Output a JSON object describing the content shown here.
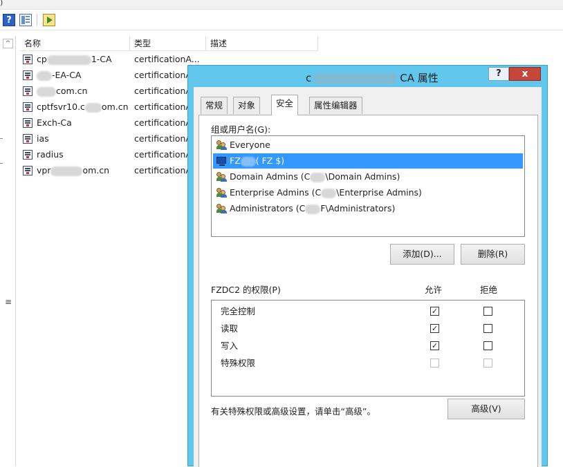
{
  "topstrip": {
    "text": ")"
  },
  "toolbar": {
    "icons": [
      "help-icon",
      "console-tree-icon",
      "action-icon"
    ],
    "help_label": "?"
  },
  "left_pane": {
    "scroll_up": "^",
    "grip": "≡"
  },
  "list": {
    "columns": [
      "名称",
      "类型",
      "描述"
    ],
    "rows": [
      {
        "name_pre": "cp",
        "name_post": "1-CA",
        "type": "certificationA...",
        "blur_w": 64
      },
      {
        "name_pre": "",
        "name_post": "-EA-CA",
        "type": "certificationA",
        "blur_w": 22
      },
      {
        "name_pre": "",
        "name_post": "com.cn",
        "type": "certificationA",
        "blur_w": 28
      },
      {
        "name_pre": "cptfsvr10.c",
        "name_post": "om.cn",
        "type": "certificationA",
        "blur_w": 24
      },
      {
        "name_pre": "Exch-Ca",
        "name_post": "",
        "type": "certificationA",
        "blur_w": 0
      },
      {
        "name_pre": "ias",
        "name_post": "",
        "type": "certificationA",
        "blur_w": 0
      },
      {
        "name_pre": "radius",
        "name_post": "",
        "type": "certificationA",
        "blur_w": 0
      },
      {
        "name_pre": "vpr",
        "name_post": "om.cn",
        "type": "certificationA",
        "blur_w": 46
      }
    ]
  },
  "dialog": {
    "title_pre": "c",
    "title_post": "CA 属性",
    "help": "?",
    "close": "x",
    "tabs": [
      "常规",
      "对象",
      "安全",
      "属性编辑器"
    ],
    "active_tab": 2,
    "group_label": "组或用户名(G):",
    "users": [
      {
        "pre": "Everyone",
        "post": "",
        "selected": false,
        "icon": "group"
      },
      {
        "pre": "FZ",
        "post": "(    FZ     $)",
        "selected": true,
        "icon": "computer"
      },
      {
        "pre": "Domain Admins (C",
        "post": "\\Domain Admins)",
        "selected": false,
        "icon": "group"
      },
      {
        "pre": "Enterprise Admins (C",
        "post": "\\Enterprise Admins)",
        "selected": false,
        "icon": "group"
      },
      {
        "pre": "Administrators (C",
        "post": "F\\Administrators)",
        "selected": false,
        "icon": "group"
      }
    ],
    "add_button": "添加(D)...",
    "remove_button": "删除(R)",
    "perm_label": "FZDC2 的权限(P)",
    "allow_header": "允许",
    "deny_header": "拒绝",
    "permissions": [
      {
        "name": "完全控制",
        "allow": true,
        "deny": false,
        "disabled": false
      },
      {
        "name": "读取",
        "allow": true,
        "deny": false,
        "disabled": false
      },
      {
        "name": "写入",
        "allow": true,
        "deny": false,
        "disabled": false
      },
      {
        "name": "特殊权限",
        "allow": false,
        "deny": false,
        "disabled": true
      }
    ],
    "advanced_text": "有关特殊权限或高级设置，请单击“高级”。",
    "advanced_button": "高级(V)",
    "check_mark": "✓"
  }
}
